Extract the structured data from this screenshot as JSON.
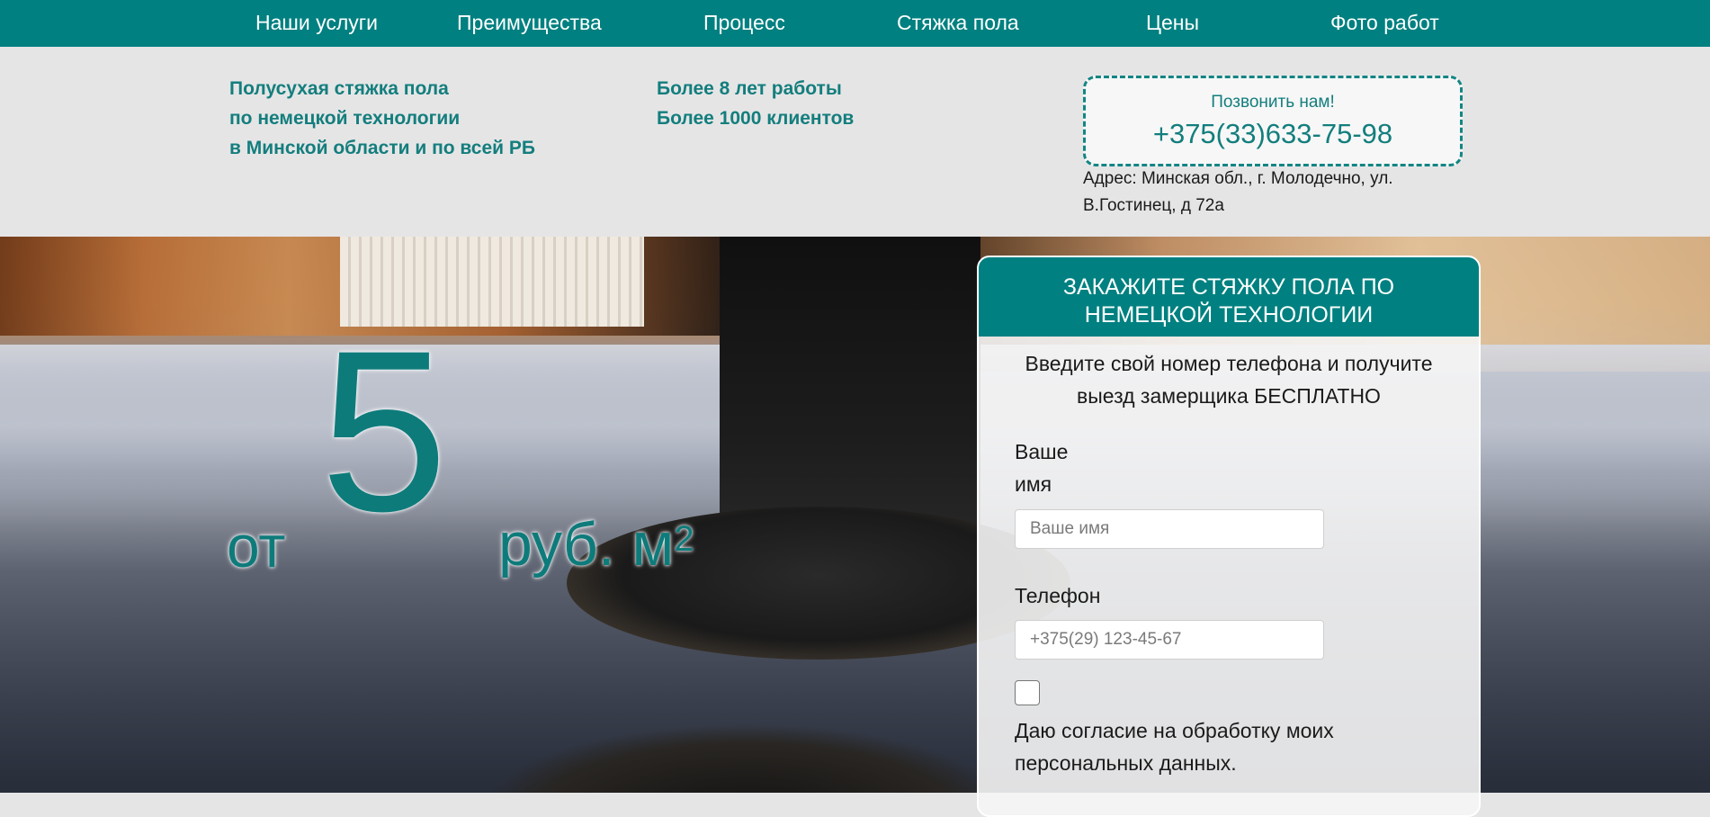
{
  "nav": {
    "items": [
      "Наши услуги",
      "Преимущества",
      "Процесс",
      "Стяжка пола",
      "Цены",
      "Фото работ"
    ]
  },
  "header": {
    "tagline": [
      "Полусухая стяжка пола",
      "по немецкой технологии",
      "в Минской области и по всей РБ"
    ],
    "stats": [
      "Более 8 лет работы",
      "Более 1000 клиентов"
    ],
    "call_label": "Позвонить нам!",
    "phone": "+375(33)633-75-98",
    "address": "Адрес: Минская обл., г. Молодечно, ул. В.Гостинец, д 72а"
  },
  "hero": {
    "price_from": "от",
    "price_value": "5",
    "price_unit": "руб. м",
    "price_unit_sup": "2"
  },
  "form": {
    "title": "ЗАКАЖИТЕ СТЯЖКУ ПОЛА ПО НЕМЕЦКОЙ ТЕХНОЛОГИИ",
    "subtitle": "Введите свой номер телефона и получите выезд замерщика БЕСПЛАТНО",
    "name_label": "Ваше имя",
    "name_placeholder": "Ваше имя",
    "phone_label": "Телефон",
    "phone_placeholder": "+375(29) 123-45-67",
    "consent": "Даю согласие на обработку моих персональных данных."
  },
  "colors": {
    "brand": "#008080",
    "brand_text": "#137e7d",
    "header_bg": "#e6e5e6"
  }
}
